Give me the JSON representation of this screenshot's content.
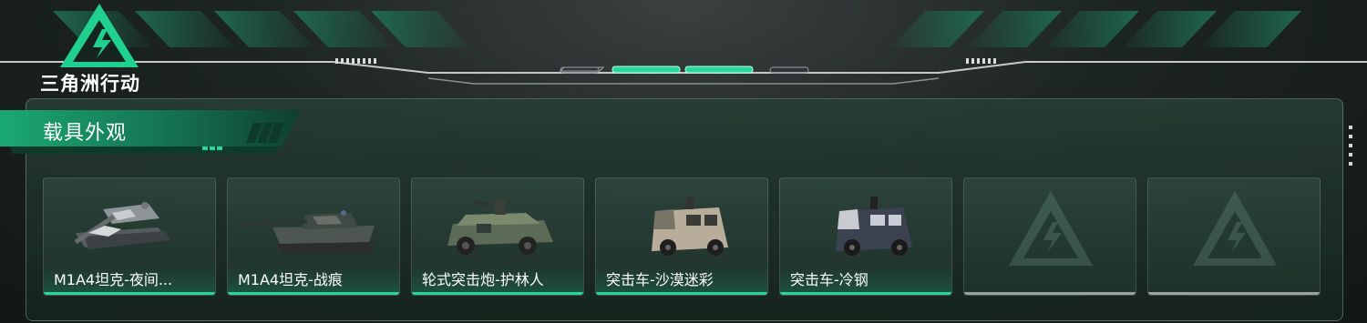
{
  "game": {
    "logo_text": "三角洲行动"
  },
  "section": {
    "title": "载具外观"
  },
  "colors": {
    "accent": "#28d69a",
    "empty_underline": "#9aa39f"
  },
  "vehicles": [
    {
      "name": "M1A4坦克-夜间...",
      "icon": "tank-icon",
      "camo": "night"
    },
    {
      "name": "M1A4坦克-战痕",
      "icon": "tank-icon",
      "camo": "battle-scar"
    },
    {
      "name": "轮式突击炮-护林人",
      "icon": "wheeled-assault-gun-icon",
      "camo": "ranger"
    },
    {
      "name": "突击车-沙漠迷彩",
      "icon": "assault-vehicle-icon",
      "camo": "desert"
    },
    {
      "name": "突击车-冷钢",
      "icon": "assault-vehicle-icon",
      "camo": "cold-steel"
    },
    {
      "name": "",
      "icon": "empty-slot-icon",
      "camo": ""
    },
    {
      "name": "",
      "icon": "empty-slot-icon",
      "camo": ""
    }
  ]
}
